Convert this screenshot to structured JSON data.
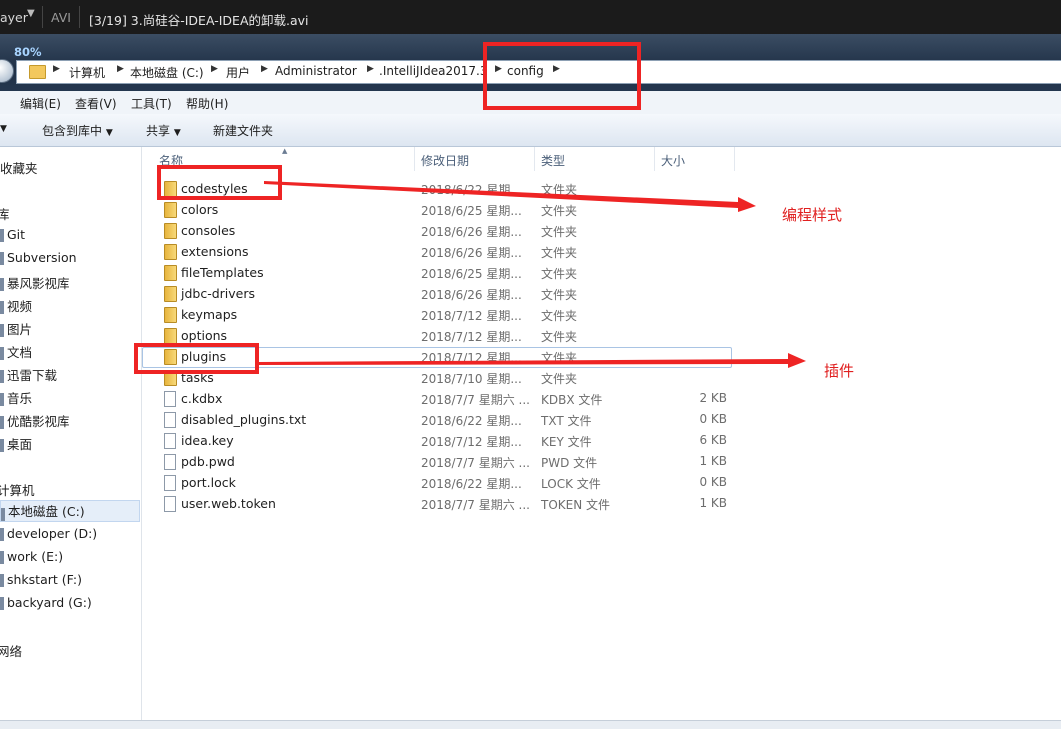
{
  "player": {
    "app_fragment": "ayer",
    "format": "AVI",
    "title": "[3/19] 3.尚硅谷-IDEA-IDEA的卸载.avi"
  },
  "zoom": "80%",
  "address": {
    "crumbs": [
      "计算机",
      "本地磁盘 (C:)",
      "用户",
      "Administrator",
      ".IntelliJIdea2017.3",
      "config"
    ]
  },
  "menu": [
    "编辑(E)",
    "查看(V)",
    "工具(T)",
    "帮助(H)"
  ],
  "toolbar": {
    "include": "包含到库中",
    "share": "共享",
    "new_folder": "新建文件夹"
  },
  "nav": {
    "favorites": "收藏夹",
    "libraries": "库",
    "library_items": [
      "Git",
      "Subversion",
      "暴风影视库",
      "视频",
      "图片",
      "文档",
      "迅雷下载",
      "音乐",
      "优酷影视库",
      "桌面"
    ],
    "computer": "计算机",
    "drives": [
      "本地磁盘 (C:)",
      "developer (D:)",
      "work (E:)",
      "shkstart (F:)",
      "backyard (G:)"
    ],
    "network": "网络"
  },
  "columns": {
    "name": "名称",
    "date": "修改日期",
    "type": "类型",
    "size": "大小"
  },
  "files": [
    {
      "name": "codestyles",
      "date": "2018/6/22 星期...",
      "type": "文件夹",
      "size": "",
      "kind": "folder"
    },
    {
      "name": "colors",
      "date": "2018/6/25 星期...",
      "type": "文件夹",
      "size": "",
      "kind": "folder"
    },
    {
      "name": "consoles",
      "date": "2018/6/26 星期...",
      "type": "文件夹",
      "size": "",
      "kind": "folder"
    },
    {
      "name": "extensions",
      "date": "2018/6/26 星期...",
      "type": "文件夹",
      "size": "",
      "kind": "folder"
    },
    {
      "name": "fileTemplates",
      "date": "2018/6/25 星期...",
      "type": "文件夹",
      "size": "",
      "kind": "folder"
    },
    {
      "name": "jdbc-drivers",
      "date": "2018/6/26 星期...",
      "type": "文件夹",
      "size": "",
      "kind": "folder"
    },
    {
      "name": "keymaps",
      "date": "2018/7/12 星期...",
      "type": "文件夹",
      "size": "",
      "kind": "folder"
    },
    {
      "name": "options",
      "date": "2018/7/12 星期...",
      "type": "文件夹",
      "size": "",
      "kind": "folder"
    },
    {
      "name": "plugins",
      "date": "2018/7/12 星期...",
      "type": "文件夹",
      "size": "",
      "kind": "folder"
    },
    {
      "name": "tasks",
      "date": "2018/7/10 星期...",
      "type": "文件夹",
      "size": "",
      "kind": "folder"
    },
    {
      "name": "c.kdbx",
      "date": "2018/7/7 星期六 ...",
      "type": "KDBX 文件",
      "size": "2 KB",
      "kind": "file"
    },
    {
      "name": "disabled_plugins.txt",
      "date": "2018/6/22 星期...",
      "type": "TXT 文件",
      "size": "0 KB",
      "kind": "file"
    },
    {
      "name": "idea.key",
      "date": "2018/7/12 星期...",
      "type": "KEY 文件",
      "size": "6 KB",
      "kind": "file"
    },
    {
      "name": "pdb.pwd",
      "date": "2018/7/7 星期六 ...",
      "type": "PWD 文件",
      "size": "1 KB",
      "kind": "file"
    },
    {
      "name": "port.lock",
      "date": "2018/6/22 星期...",
      "type": "LOCK 文件",
      "size": "0 KB",
      "kind": "file"
    },
    {
      "name": "user.web.token",
      "date": "2018/7/7 星期六 ...",
      "type": "TOKEN 文件",
      "size": "1 KB",
      "kind": "file"
    }
  ],
  "annotations": {
    "codestyles_note": "编程样式",
    "plugins_note": "插件",
    "color": "#ee2424"
  }
}
